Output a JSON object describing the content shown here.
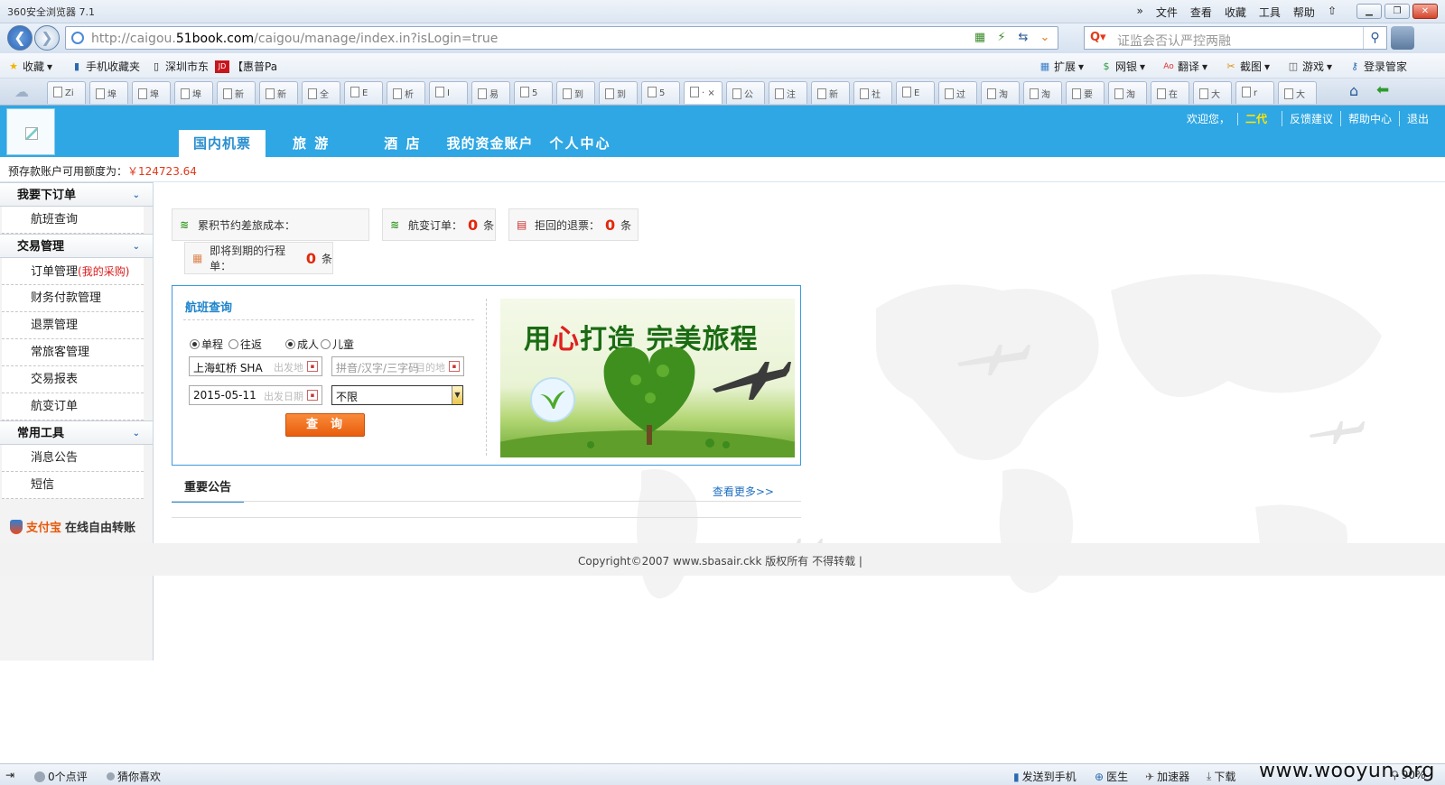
{
  "browser": {
    "title": "360安全浏览器 7.1",
    "menu": [
      "文件",
      "查看",
      "收藏",
      "工具",
      "帮助"
    ],
    "url_prefix": "http://caigou.",
    "url_domain": "51book.com",
    "url_rest": "/caigou/manage/index.in?isLogin=true",
    "search_placeholder": "证监会否认严控两融",
    "favorites": [
      "收藏",
      "手机收藏夹",
      "深圳市东",
      "【惠普Pa"
    ],
    "right_tools": [
      "扩展",
      "网银",
      "翻译",
      "截图",
      "游戏",
      "登录管家"
    ],
    "tabs": [
      "Zi",
      "埠",
      "埠",
      "埠",
      "新",
      "新",
      "全",
      "E",
      "析",
      "I",
      "易",
      "5",
      "到",
      "到",
      "5",
      "· ×",
      "公",
      "注",
      "新",
      "社",
      "E",
      "过",
      "淘",
      "淘",
      "要",
      "淘",
      "在",
      "大",
      "r",
      "大"
    ]
  },
  "site": {
    "nav": [
      "国内机票",
      "旅 游",
      "酒 店",
      "我的资金账户",
      "个人中心"
    ],
    "welcome": "欢迎您，",
    "username": "二代",
    "links": [
      "反馈建议",
      "帮助中心",
      "退出"
    ],
    "balance_label": "预存款账户可用额度为：",
    "balance_amount": "￥124723.64"
  },
  "sidebar": {
    "groups": [
      {
        "title": "我要下订单",
        "items": [
          "航班查询"
        ]
      },
      {
        "title": "交易管理",
        "items": [
          "订单管理",
          "财务付款管理",
          "退票管理",
          "常旅客管理",
          "交易报表",
          "航变订单"
        ]
      },
      {
        "title": "常用工具",
        "items": [
          "消息公告",
          "短信"
        ]
      }
    ],
    "order_suffix": "(我的采购)",
    "alipay_brand": "支付宝",
    "alipay_text": "在线自由转账"
  },
  "stats": {
    "saving_label": "累积节约差旅成本：",
    "change_label": "航变订单：",
    "change_count": "0",
    "refund_label": "拒回的退票：",
    "refund_count": "0",
    "expire_label": "即将到期的行程单：",
    "expire_count": "0",
    "unit": "条"
  },
  "flight_search": {
    "title": "航班查询",
    "trip_one_way": "单程",
    "trip_round": "往返",
    "adult": "成人",
    "child": "儿童",
    "from_value": "上海虹桥 SHA",
    "from_hint": "出发地",
    "to_placeholder": "拼音/汉字/三字码",
    "to_hint": "目的地",
    "date_value": "2015-05-11",
    "date_hint": "出发日期",
    "airline_value": "不限",
    "query_button": "查询",
    "banner_slogan_1": "用",
    "banner_slogan_heart": "心",
    "banner_slogan_2": "打造  完美旅程"
  },
  "notice": {
    "title": "重要公告",
    "more": "查看更多>>"
  },
  "footer": {
    "copyright": "Copyright©2007     www.sbasair.ckk   版权所有 不得转载 |"
  },
  "statusbar": {
    "clicks": "0个点评",
    "guess": "猜你喜欢",
    "send_phone": "发送到手机",
    "doctor": "医生",
    "accelerate": "加速器",
    "download": "下载",
    "zoom": "90%",
    "watermark": "www.wooyun.org"
  }
}
